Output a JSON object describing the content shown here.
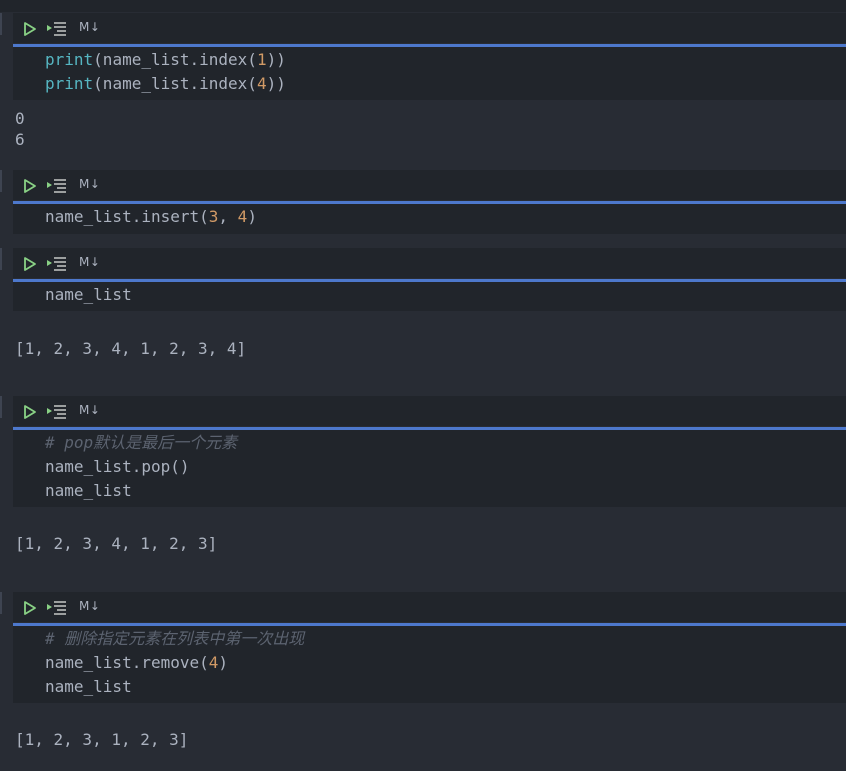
{
  "cells": [
    {
      "code": [
        {
          "parts": [
            {
              "t": "print",
              "c": "kw-fn"
            },
            {
              "t": "(name_list.index(",
              "c": ""
            },
            {
              "t": "1",
              "c": "num"
            },
            {
              "t": "))",
              "c": ""
            }
          ]
        },
        {
          "parts": [
            {
              "t": "print",
              "c": "kw-fn"
            },
            {
              "t": "(name_list.index(",
              "c": ""
            },
            {
              "t": "4",
              "c": "num"
            },
            {
              "t": "))",
              "c": ""
            }
          ]
        }
      ],
      "output": [
        "0",
        "6"
      ]
    },
    {
      "code": [
        {
          "parts": [
            {
              "t": "name_list.insert(",
              "c": ""
            },
            {
              "t": "3",
              "c": "num"
            },
            {
              "t": ", ",
              "c": ""
            },
            {
              "t": "4",
              "c": "num"
            },
            {
              "t": ")",
              "c": ""
            }
          ]
        }
      ],
      "output": []
    },
    {
      "code": [
        {
          "parts": [
            {
              "t": "name_list",
              "c": ""
            }
          ]
        }
      ],
      "output": [
        "[1, 2, 3, 4, 1, 2, 3, 4]"
      ]
    },
    {
      "code": [
        {
          "parts": [
            {
              "t": "# pop默认是最后一个元素",
              "c": "comment"
            }
          ]
        },
        {
          "parts": [
            {
              "t": "name_list.pop()",
              "c": ""
            }
          ]
        },
        {
          "parts": [
            {
              "t": "name_list",
              "c": ""
            }
          ]
        }
      ],
      "output": [
        "[1, 2, 3, 4, 1, 2, 3]"
      ]
    },
    {
      "code": [
        {
          "parts": [
            {
              "t": "# 删除指定元素在列表中第一次出现",
              "c": "comment"
            }
          ]
        },
        {
          "parts": [
            {
              "t": "name_list.remove(",
              "c": ""
            },
            {
              "t": "4",
              "c": "num"
            },
            {
              "t": ")",
              "c": ""
            }
          ]
        },
        {
          "parts": [
            {
              "t": "name_list",
              "c": ""
            }
          ]
        }
      ],
      "output": [
        "[1, 2, 3, 1, 2, 3]"
      ]
    }
  ],
  "toolbar": {
    "md_label": "M↓",
    "run_icon": "play-icon",
    "run_all_icon": "run-all-icon"
  },
  "colors": {
    "accent": "#4d78cc",
    "play": "#89d185",
    "background": "#282c34",
    "cell_bg": "#21252b"
  }
}
